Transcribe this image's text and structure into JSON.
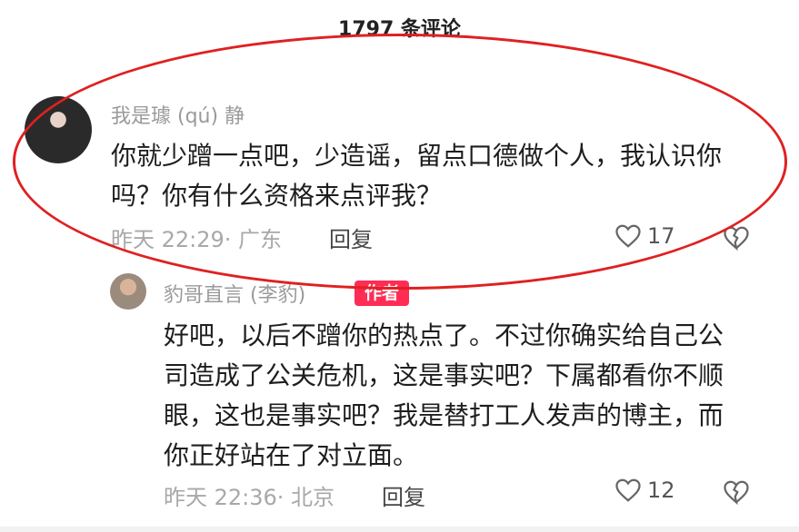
{
  "header": {
    "title": "1797 条评论"
  },
  "comments": [
    {
      "user": "我是璩 (qú) 静",
      "text": "你就少蹭一点吧，少造谣，留点口德做个人，我认识你吗？你有什么资格来点评我？",
      "time_location": "昨天 22:29· 广东",
      "reply_label": "回复",
      "likes": "17"
    }
  ],
  "replies": [
    {
      "user": "豹哥直言 (李豹)",
      "badge": "作者",
      "text": "好吧，以后不蹭你的热点了。不过你确实给自己公司造成了公关危机，这是事实吧？下属都看你不顺眼，这也是事实吧？我是替打工人发声的博主，而你正好站在了对立面。",
      "time_location": "昨天 22:36· 北京",
      "reply_label": "回复",
      "likes": "12"
    }
  ],
  "colors": {
    "badge": "#ff2d55",
    "annotation_ellipse": "#e02020",
    "muted_text": "#9a9a9a"
  }
}
